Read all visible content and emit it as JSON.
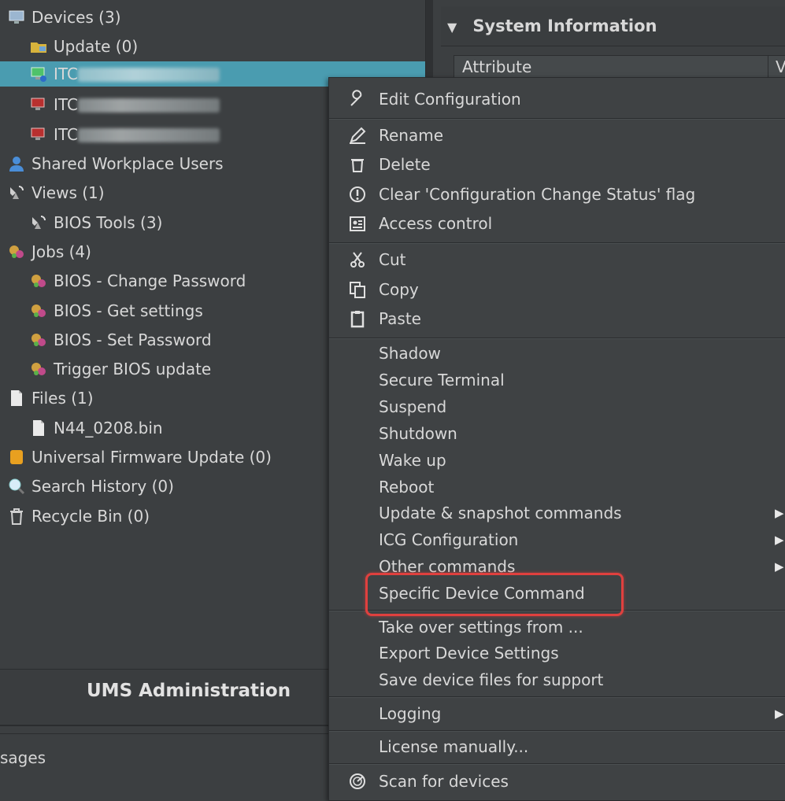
{
  "tree": {
    "items": [
      {
        "label": "Devices (3)"
      },
      {
        "label": "Update (0)"
      },
      {
        "label": "ITC"
      },
      {
        "label": "ITC"
      },
      {
        "label": "ITC"
      },
      {
        "label": "Shared Workplace Users"
      },
      {
        "label": "Views (1)"
      },
      {
        "label": "BIOS Tools (3)"
      },
      {
        "label": "Jobs (4)"
      },
      {
        "label": "BIOS - Change Password"
      },
      {
        "label": "BIOS - Get settings"
      },
      {
        "label": "BIOS - Set Password"
      },
      {
        "label": "Trigger BIOS update"
      },
      {
        "label": "Files (1)"
      },
      {
        "label": "N44_0208.bin"
      },
      {
        "label": "Universal Firmware Update (0)"
      },
      {
        "label": "Search History (0)"
      },
      {
        "label": "Recycle Bin (0)"
      }
    ]
  },
  "panels": {
    "admin_title": "UMS Administration",
    "messages_partial": "sages"
  },
  "right": {
    "section_title": "System Information",
    "attr_header": "Attribute",
    "value_header_partial": "V"
  },
  "menu": {
    "edit_configuration": "Edit Configuration",
    "rename": "Rename",
    "delete": "Delete",
    "clear_flag": "Clear 'Configuration Change Status' flag",
    "access_control": "Access control",
    "cut": "Cut",
    "copy": "Copy",
    "paste": "Paste",
    "shadow": "Shadow",
    "secure_terminal": "Secure Terminal",
    "suspend": "Suspend",
    "shutdown": "Shutdown",
    "wake_up": "Wake up",
    "reboot": "Reboot",
    "update_snapshot": "Update & snapshot commands",
    "icg_configuration": "ICG Configuration",
    "other_commands": "Other commands",
    "specific_device_command": "Specific Device Command",
    "take_over_settings": "Take over settings from ...",
    "export_device_settings": "Export Device Settings",
    "save_device_files": "Save device files for support",
    "logging": "Logging",
    "license_manually": "License manually...",
    "scan_for_devices": "Scan for devices"
  },
  "icons": {
    "submenu": "▶",
    "expand": "▼",
    "wrench": "wrench-icon",
    "pencil": "pencil-icon",
    "trash": "trash-icon",
    "exclamation": "exclamation-circle-icon",
    "access": "access-card-icon",
    "scissors": "scissors-icon",
    "copy": "copy-icon",
    "clipboard": "clipboard-icon",
    "radar": "radar-icon"
  },
  "colors": {
    "selection": "#4a9cb0",
    "highlight_box": "#e0403e",
    "menu_bg": "#3f4244",
    "panel_bg": "#3c3f41"
  }
}
